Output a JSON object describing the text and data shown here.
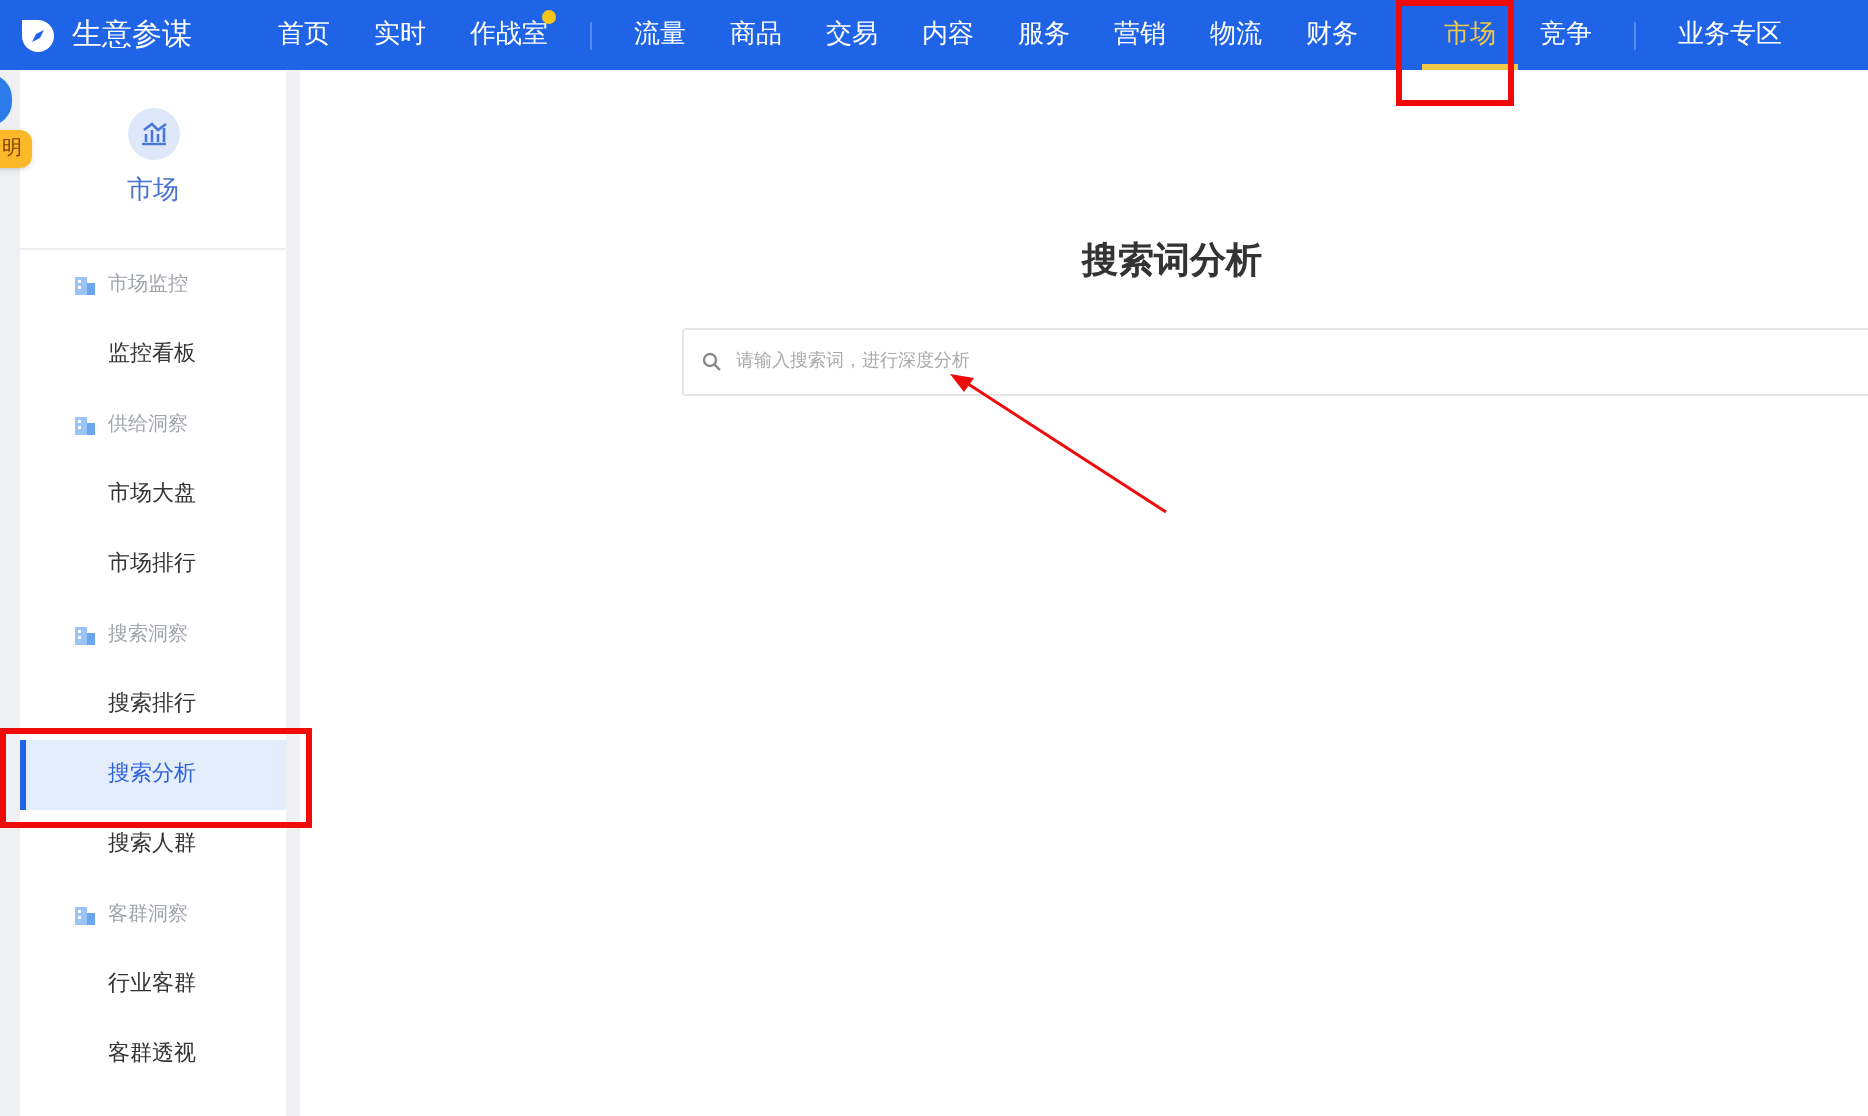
{
  "brand": {
    "name": "生意参谋"
  },
  "nav": {
    "groups": [
      [
        {
          "label": "首页",
          "selected": false,
          "dot": false
        },
        {
          "label": "实时",
          "selected": false,
          "dot": false
        },
        {
          "label": "作战室",
          "selected": false,
          "dot": true
        }
      ],
      [
        {
          "label": "流量",
          "selected": false,
          "dot": false
        },
        {
          "label": "商品",
          "selected": false,
          "dot": false
        },
        {
          "label": "交易",
          "selected": false,
          "dot": false
        },
        {
          "label": "内容",
          "selected": false,
          "dot": false
        },
        {
          "label": "服务",
          "selected": false,
          "dot": false
        },
        {
          "label": "营销",
          "selected": false,
          "dot": false
        },
        {
          "label": "物流",
          "selected": false,
          "dot": false
        },
        {
          "label": "财务",
          "selected": false,
          "dot": false
        }
      ],
      [
        {
          "label": "市场",
          "selected": true,
          "dot": false
        },
        {
          "label": "竞争",
          "selected": false,
          "dot": false
        }
      ],
      [
        {
          "label": "业务专区",
          "selected": false,
          "dot": false
        }
      ]
    ]
  },
  "help_badge": {
    "label": "明"
  },
  "sidebar": {
    "title": "市场",
    "sections": [
      {
        "label": "市场监控",
        "items": [
          {
            "label": "监控看板",
            "selected": false
          }
        ]
      },
      {
        "label": "供给洞察",
        "items": [
          {
            "label": "市场大盘",
            "selected": false
          },
          {
            "label": "市场排行",
            "selected": false
          }
        ]
      },
      {
        "label": "搜索洞察",
        "items": [
          {
            "label": "搜索排行",
            "selected": false
          },
          {
            "label": "搜索分析",
            "selected": true
          },
          {
            "label": "搜索人群",
            "selected": false
          }
        ]
      },
      {
        "label": "客群洞察",
        "items": [
          {
            "label": "行业客群",
            "selected": false
          },
          {
            "label": "客群透视",
            "selected": false
          }
        ]
      }
    ]
  },
  "main": {
    "title": "搜索词分析",
    "search": {
      "placeholder": "请输入搜索词，进行深度分析"
    }
  }
}
